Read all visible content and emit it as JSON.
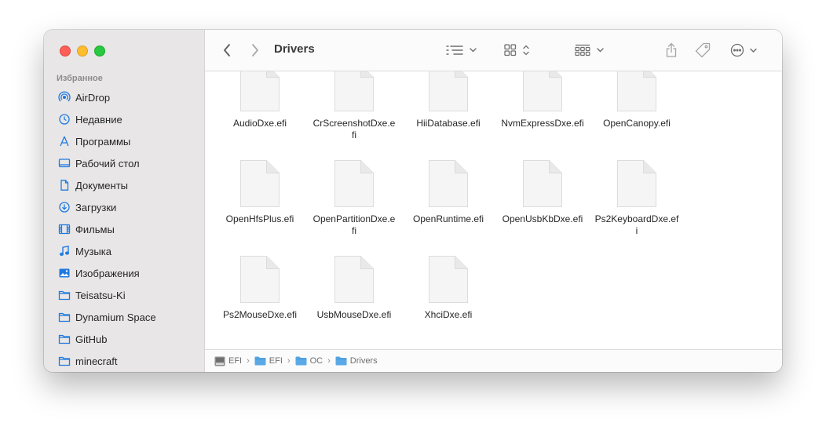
{
  "window": {
    "title": "Drivers"
  },
  "sidebar": {
    "heading": "Избранное",
    "items": [
      {
        "label": "AirDrop",
        "icon": "airdrop-icon"
      },
      {
        "label": "Недавние",
        "icon": "clock-icon"
      },
      {
        "label": "Программы",
        "icon": "applications-icon"
      },
      {
        "label": "Рабочий стол",
        "icon": "desktop-icon"
      },
      {
        "label": "Документы",
        "icon": "document-icon"
      },
      {
        "label": "Загрузки",
        "icon": "download-icon"
      },
      {
        "label": "Фильмы",
        "icon": "film-icon"
      },
      {
        "label": "Музыка",
        "icon": "music-icon"
      },
      {
        "label": "Изображения",
        "icon": "photo-icon"
      },
      {
        "label": "Teisatsu-Ki",
        "icon": "folder-icon"
      },
      {
        "label": "Dynamium Space",
        "icon": "folder-icon"
      },
      {
        "label": "GitHub",
        "icon": "folder-icon"
      },
      {
        "label": "minecraft",
        "icon": "folder-icon"
      }
    ]
  },
  "files": [
    {
      "name": "AudioDxe.efi"
    },
    {
      "name": "CrScreenshotDxe.efi"
    },
    {
      "name": "HiiDatabase.efi"
    },
    {
      "name": "NvmExpressDxe.efi"
    },
    {
      "name": "OpenCanopy.efi"
    },
    {
      "name": "OpenHfsPlus.efi"
    },
    {
      "name": "OpenPartitionDxe.efi"
    },
    {
      "name": "OpenRuntime.efi"
    },
    {
      "name": "OpenUsbKbDxe.efi"
    },
    {
      "name": "Ps2KeyboardDxe.efi"
    },
    {
      "name": "Ps2MouseDxe.efi"
    },
    {
      "name": "UsbMouseDxe.efi"
    },
    {
      "name": "XhciDxe.efi"
    }
  ],
  "pathbar": {
    "items": [
      {
        "label": "EFI",
        "icon": "disk-icon"
      },
      {
        "label": "EFI",
        "icon": "folder-icon"
      },
      {
        "label": "OC",
        "icon": "folder-icon"
      },
      {
        "label": "Drivers",
        "icon": "folder-icon"
      }
    ],
    "separator": "›"
  },
  "colors": {
    "accent": "#1f7ae0",
    "folder": "#5aa9e6",
    "sidebar_bg": "#e8e6e6"
  }
}
